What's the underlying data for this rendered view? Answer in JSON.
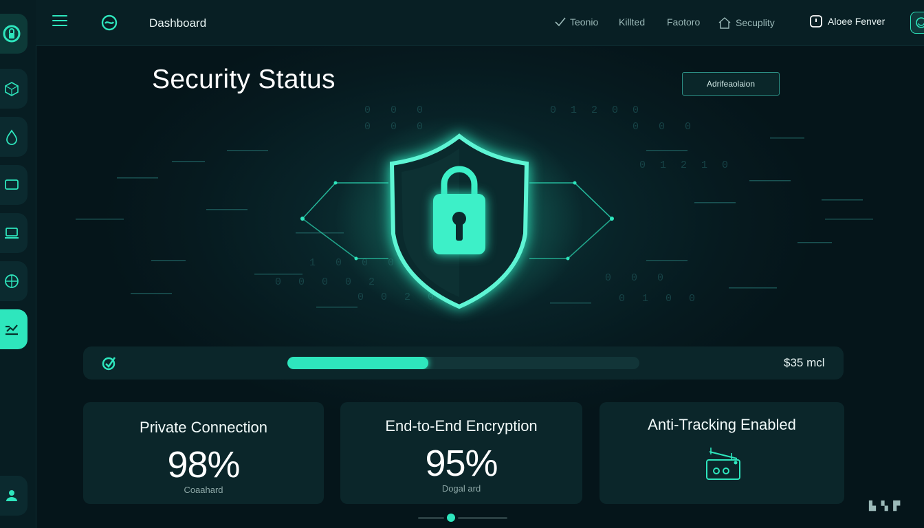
{
  "topbar": {
    "title": "Dashboard",
    "nav": [
      "Teonio",
      "Killted",
      "Faotoro",
      "Secuplity"
    ],
    "user_name": "Aloee Fenver"
  },
  "page": {
    "title": "Security Status",
    "action_button": "Adrifeaolaion"
  },
  "progress": {
    "fraction": 0.4,
    "value_text": "$35 mcl"
  },
  "cards": [
    {
      "title": "Private Connection",
      "value": "98%",
      "caption": "Coaahard"
    },
    {
      "title": "End-to-End Encryption",
      "value": "95%",
      "caption": "Dogal ard"
    },
    {
      "title": "Anti-Tracking Enabled"
    }
  ],
  "sidebar": {
    "items": [
      "shield-icon",
      "cube-icon",
      "drop-icon",
      "monitor-icon",
      "laptop-icon",
      "globe-icon",
      "chart-icon",
      "user-icon"
    ],
    "active_index": 6
  },
  "colors": {
    "accent": "#2ee6bd",
    "background": "#06161b",
    "card": "#0b262a"
  }
}
